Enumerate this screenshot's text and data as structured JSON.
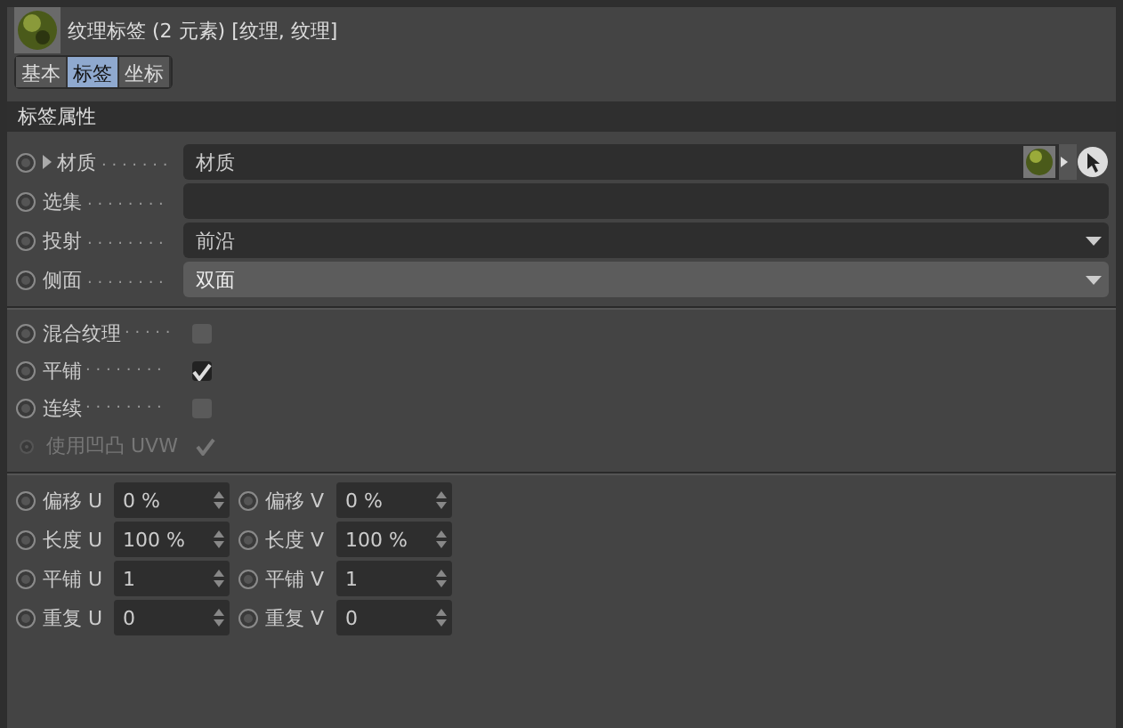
{
  "header": {
    "title": "纹理标签 (2 元素) [纹理, 纹理]"
  },
  "tabs": [
    {
      "label": "基本",
      "selected": false
    },
    {
      "label": "标签",
      "selected": true
    },
    {
      "label": "坐标",
      "selected": false
    }
  ],
  "section": {
    "title": "标签属性"
  },
  "fields": [
    {
      "kind": "link",
      "label": "材质",
      "dots": ". . . . . . .",
      "value": "材质"
    },
    {
      "kind": "text",
      "label": "选集",
      "dots": ". . . . . . . ."
    },
    {
      "kind": "dropdown",
      "label": "投射",
      "dots": ". . . . . . . .",
      "value": "前沿"
    },
    {
      "kind": "dropdown-light",
      "label": "侧面",
      "dots": ". . . . . . . .",
      "value": "双面"
    }
  ],
  "checks": [
    {
      "label": "混合纹理",
      "dots": ". . . . .",
      "checked": false,
      "disabled": false
    },
    {
      "label": "平铺",
      "dots": ". . . . . . . .",
      "checked": true,
      "disabled": false
    },
    {
      "label": "连续",
      "dots": ". . . . . . . .",
      "checked": false,
      "disabled": false
    },
    {
      "label": "使用凹凸 UVW",
      "checked": true,
      "disabled": true
    }
  ],
  "spinners": [
    [
      {
        "label": "偏移 U",
        "value": "0 %"
      },
      {
        "label": "偏移 V",
        "value": "0 %"
      }
    ],
    [
      {
        "label": "长度 U",
        "value": "100 %"
      },
      {
        "label": "长度 V",
        "value": "100 %"
      }
    ],
    [
      {
        "label": "平铺 U",
        "value": "1"
      },
      {
        "label": "平铺 V",
        "value": "1"
      }
    ],
    [
      {
        "label": "重复 U",
        "value": "0"
      },
      {
        "label": "重复 V",
        "value": "0"
      }
    ]
  ]
}
